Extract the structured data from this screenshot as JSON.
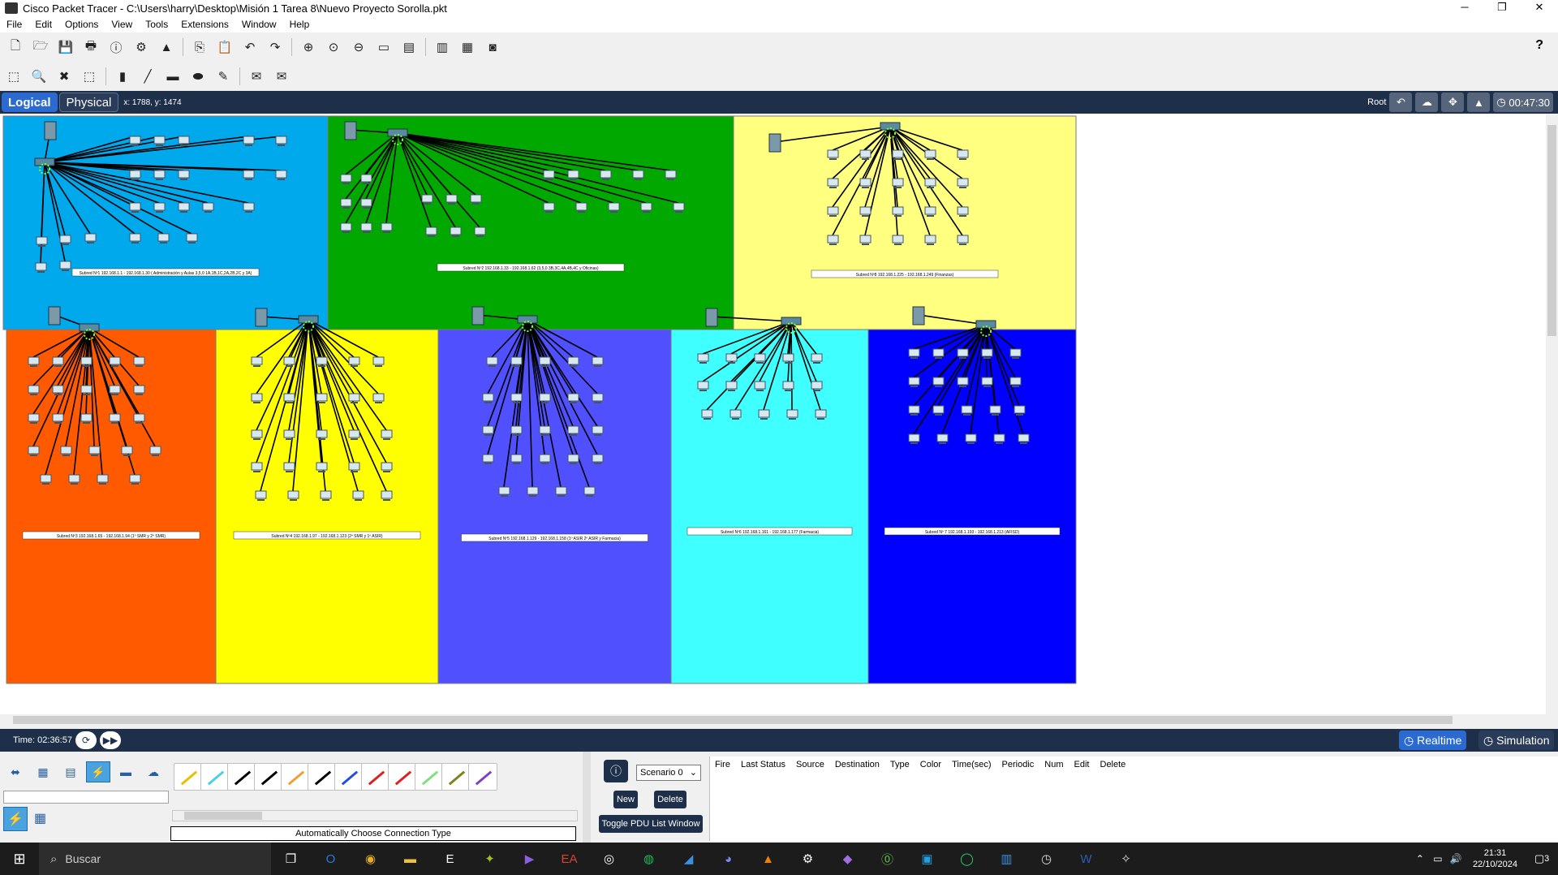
{
  "window": {
    "title": "Cisco Packet Tracer - C:\\Users\\harry\\Desktop\\Misión 1 Tarea 8\\Nuevo Proyecto Sorolla.pkt",
    "controls": [
      "─",
      "❐",
      "✕"
    ]
  },
  "menu": [
    "File",
    "Edit",
    "Options",
    "View",
    "Tools",
    "Extensions",
    "Window",
    "Help"
  ],
  "toolbar_main": [
    "new-icon",
    "open-icon",
    "save-icon",
    "print-icon",
    "info-icon",
    "network-wizard-icon",
    "activity-wizard-icon",
    "copy-icon",
    "paste-icon",
    "undo-icon",
    "redo-icon",
    "zoom-in-icon",
    "zoom-reset-icon",
    "zoom-out-icon",
    "drawing-palette-icon",
    "custom-device-icon",
    "viewport-icon",
    "cluster-icon",
    "capture-icon"
  ],
  "toolbar_main_glyphs": [
    "🗋",
    "🗁",
    "💾",
    "🖶",
    "ⓘ",
    "⚙",
    "▲",
    "⎘",
    "📋",
    "↶",
    "↷",
    "⊕",
    "⊙",
    "⊖",
    "▭",
    "▤",
    "▥",
    "▦",
    "◙"
  ],
  "toolbar_tools_glyphs": [
    "⬚",
    "🔍",
    "✖",
    "⬚",
    "▮",
    "╱",
    "▬",
    "⬬",
    "✎",
    "✉",
    "✉"
  ],
  "toolbar_tools": [
    "select-icon",
    "inspect-icon",
    "delete-icon",
    "resize-icon",
    "note-icon",
    "line-icon",
    "rectangle-icon",
    "ellipse-icon",
    "freeform-icon",
    "simple-pdu-icon",
    "complex-pdu-icon"
  ],
  "help_label": "?",
  "workspace": {
    "logical_label": "Logical",
    "physical_label": "Physical",
    "coords": "x: 1788, y: 1474",
    "root_label": "Root",
    "clock": "00:47:30"
  },
  "zones": [
    {
      "name": "zone-administracion",
      "color": "#00a8ec",
      "label": "Subred Nº1 192.168.1.1 - 192.168.1.30 ( Administración y Aulas 3,5,0 1A,1B,1C,2A,2B,2C y 3A)"
    },
    {
      "name": "zone-oficinas",
      "color": "#00a800",
      "label": "Subred Nº2 192.168.1.33 - 192.168.1.62 (3,5,0 3B,3C,4A,4B,4C y Oficinas)"
    },
    {
      "name": "zone-finanzas",
      "color": "#ffff80",
      "label": "Subred Nº8 192.168.1.225 - 192.168.1.249 (Finanzas)"
    },
    {
      "name": "zone-smr1",
      "color": "#ff5a00",
      "label": "Subred Nº3 192.168.1.65 - 192.168.1.94 (1º SMR y 2º SMR)"
    },
    {
      "name": "zone-smr2",
      "color": "#ffff00",
      "label": "Subred Nº4 192.168.1.97 - 192.168.1.123 (2º SMR y 1º ASIR)"
    },
    {
      "name": "zone-asir",
      "color": "#5050ff",
      "label": "Subred Nº5 192.168.1.129 - 192.168.1.158 (1º ASIR 2º ASIR y Farmacia)"
    },
    {
      "name": "zone-farmacia",
      "color": "#40ffff",
      "label": "Subred Nº6 192.168.1.161 - 192.168.1.177 (Farmacia)"
    },
    {
      "name": "zone-afisd",
      "color": "#0000ff",
      "label": "Subred Nº 7 192.168.1.193 - 192.168.1.213 (AFISD)"
    }
  ],
  "status": {
    "time": "Time: 02:36:57",
    "realtime_label": "Realtime",
    "simulation_label": "Simulation"
  },
  "device_panel": {
    "connection_desc": "Automatically Choose Connection Type"
  },
  "pdu": {
    "scenario": "Scenario 0",
    "new_label": "New",
    "delete_label": "Delete",
    "toggle_label": "Toggle PDU List Window",
    "columns": [
      "Fire",
      "Last Status",
      "Source",
      "Destination",
      "Type",
      "Color",
      "Time(sec)",
      "Periodic",
      "Num",
      "Edit",
      "Delete"
    ]
  },
  "taskbar": {
    "search_placeholder": "Buscar",
    "time": "21:31",
    "date": "22/10/2024",
    "notification_count": "3"
  }
}
